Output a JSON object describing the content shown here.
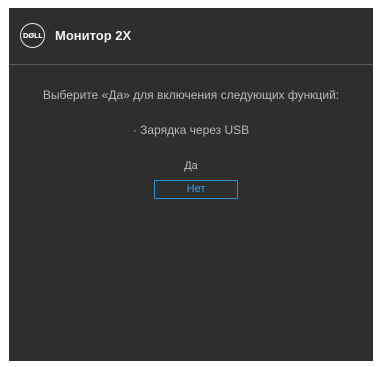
{
  "window": {
    "logo_text": "DØLL",
    "title": "Монитор 2X"
  },
  "dialog": {
    "prompt": "Выберите «Да» для включения следующих функций:",
    "feature": "· Зарядка через USB",
    "options": {
      "yes_label": "Да",
      "no_label": "Нет",
      "selected": "Нет"
    }
  },
  "colors": {
    "panel_bg": "#2e2e2e",
    "accent": "#2f8fd0",
    "text": "#b9b9b9"
  }
}
